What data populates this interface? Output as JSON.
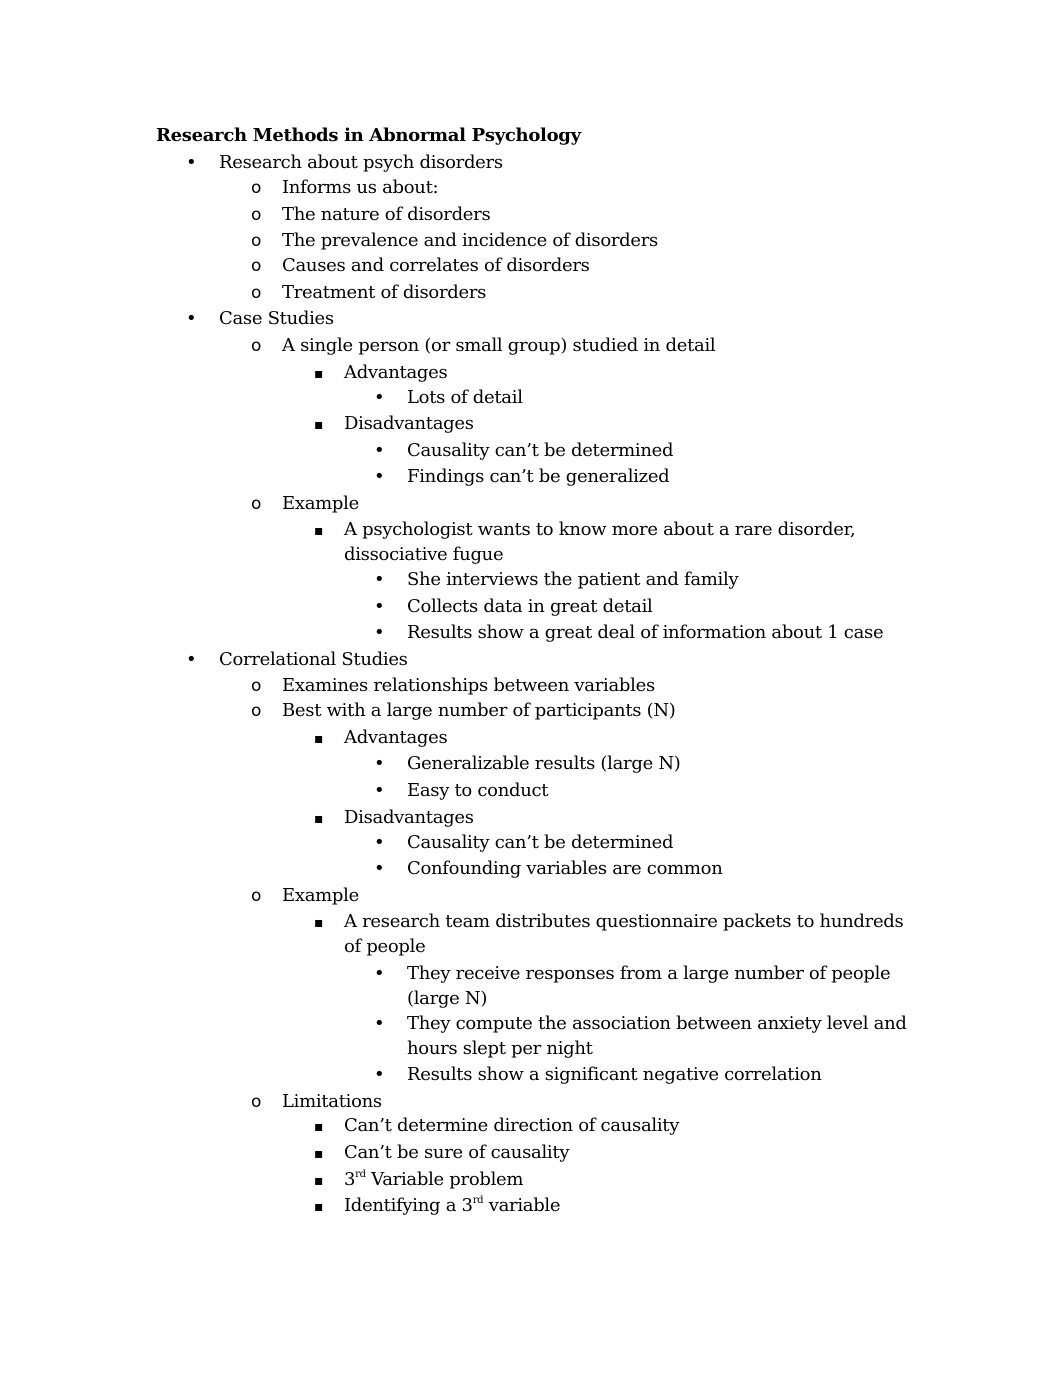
{
  "document": {
    "title": "Research Methods in Abnormal Psychology",
    "lines": [
      {
        "level": 1,
        "text": "Research about psych disorders"
      },
      {
        "level": 2,
        "text": "Informs us about:"
      },
      {
        "level": 2,
        "text": "The nature of disorders"
      },
      {
        "level": 2,
        "text": "The prevalence and incidence of disorders"
      },
      {
        "level": 2,
        "text": "Causes and correlates of disorders"
      },
      {
        "level": 2,
        "text": "Treatment of disorders"
      },
      {
        "level": 1,
        "text": "Case Studies"
      },
      {
        "level": 2,
        "text": "A single person (or small group) studied in detail"
      },
      {
        "level": 3,
        "text": "Advantages"
      },
      {
        "level": 4,
        "text": "Lots of detail"
      },
      {
        "level": 3,
        "text": "Disadvantages"
      },
      {
        "level": 4,
        "text": "Causality can’t be determined"
      },
      {
        "level": 4,
        "text": "Findings can’t be generalized"
      },
      {
        "level": 2,
        "text": "Example"
      },
      {
        "level": 3,
        "text": "A psychologist wants to know more about a rare disorder,",
        "cont": "dissociative fugue"
      },
      {
        "level": 4,
        "text": "She interviews the patient and family"
      },
      {
        "level": 4,
        "text": "Collects data in great detail"
      },
      {
        "level": 4,
        "text": "Results show a great deal of information about 1 case"
      },
      {
        "level": 1,
        "text": "Correlational Studies"
      },
      {
        "level": 2,
        "text": "Examines relationships between variables"
      },
      {
        "level": 2,
        "text": "Best with a large number of participants (N)"
      },
      {
        "level": 3,
        "text": "Advantages"
      },
      {
        "level": 4,
        "text": "Generalizable results (large N)"
      },
      {
        "level": 4,
        "text": "Easy to conduct"
      },
      {
        "level": 3,
        "text": "Disadvantages"
      },
      {
        "level": 4,
        "text": "Causality can’t be determined"
      },
      {
        "level": 4,
        "text": "Confounding variables are common"
      },
      {
        "level": 2,
        "text": "Example"
      },
      {
        "level": 3,
        "text": "A research team distributes questionnaire packets to hundreds",
        "cont": "of people"
      },
      {
        "level": 4,
        "text": "They receive responses from a large number of people",
        "cont": "(large N)"
      },
      {
        "level": 4,
        "text": "They compute the association between anxiety level and",
        "cont": "hours slept per night"
      },
      {
        "level": 4,
        "text": "Results show a significant negative correlation"
      },
      {
        "level": 2,
        "text": "Limitations"
      },
      {
        "level": 3,
        "text": "Can’t determine direction of causality"
      },
      {
        "level": 3,
        "text": "Can’t be sure of causality"
      },
      {
        "level": 3,
        "pre": "3",
        "sup": "rd",
        "post": " Variable problem"
      },
      {
        "level": 3,
        "pre": "Identifying a 3",
        "sup": "rd",
        "post": " variable"
      }
    ]
  },
  "icons": {
    "level1": "disc-bullet-icon",
    "level2": "circle-bullet-icon",
    "level3": "square-bullet-icon",
    "level4": "disc-bullet-icon"
  }
}
